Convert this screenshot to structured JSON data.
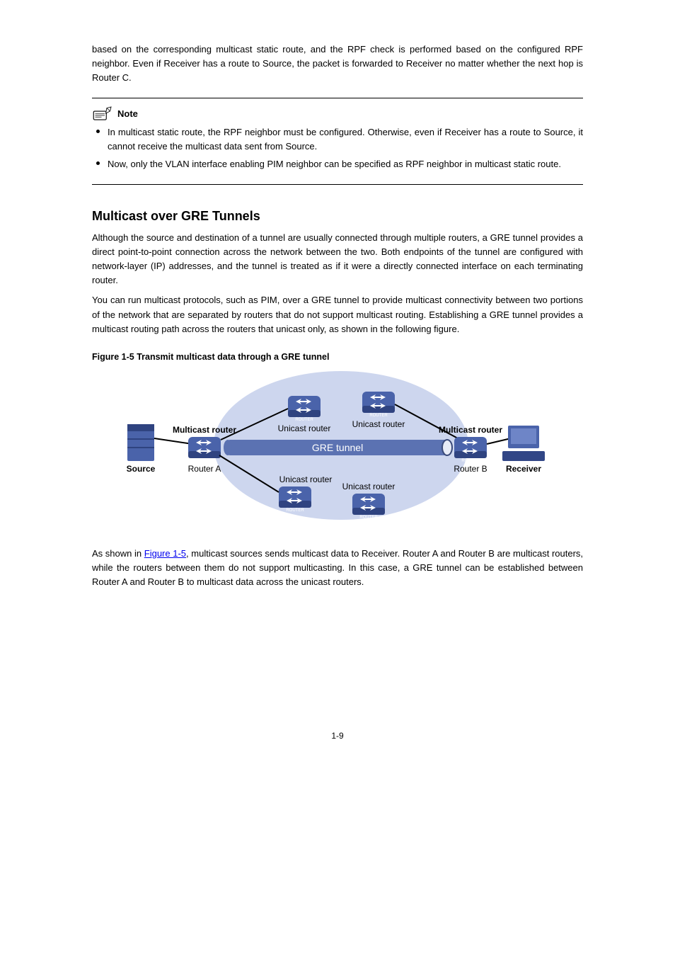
{
  "intro_para": "based on the corresponding multicast static route, and the RPF check is performed based on the configured RPF neighbor. Even if Receiver has a route to Source, the packet is forwarded to Receiver no matter whether the next hop is Router C.",
  "note": {
    "label": "Note",
    "items": [
      "In multicast static route, the RPF neighbor must be configured. Otherwise, even if Receiver has a route to Source, it cannot receive the multicast data sent from Source.",
      "Now, only the VLAN interface enabling PIM neighbor can be specified as RPF neighbor in multicast static route."
    ]
  },
  "section": {
    "title": "Multicast over GRE Tunnels",
    "para1": "Although the source and destination of a tunnel are usually connected through multiple routers, a GRE tunnel provides a direct point-to-point connection across the network between the two. Both endpoints of the tunnel are configured with network-layer (IP) addresses, and the tunnel is treated as if it were a directly connected interface on each terminating router.",
    "para2": "You can run multicast protocols, such as PIM, over a GRE tunnel to provide multicast connectivity between two portions of the network that are separated by routers that do not support multicast routing. Establishing a GRE tunnel provides a multicast routing path across the routers that unicast only, as shown in the following figure."
  },
  "figure": {
    "caption": "Figure 1-5 Transmit multicast data through a GRE tunnel",
    "labels": {
      "mcast_router": "Multicast router",
      "unicast_router": "Unicast router",
      "gre_tunnel": "GRE tunnel",
      "source": "Source",
      "receiver": "Receiver",
      "router_a": "Router A",
      "router_b": "Router B"
    }
  },
  "post_figure": {
    "link_text": "Figure 1-5",
    "after_link": ", multicast sources sends multicast data to Receiver. Router A and Router B are multicast routers, while the routers between them do not support multicasting. In this case, a GRE tunnel can be established between Router A and Router B to multicast data across the unicast routers."
  },
  "as_shown_prefix": "As shown in ",
  "page_num": "1-9"
}
